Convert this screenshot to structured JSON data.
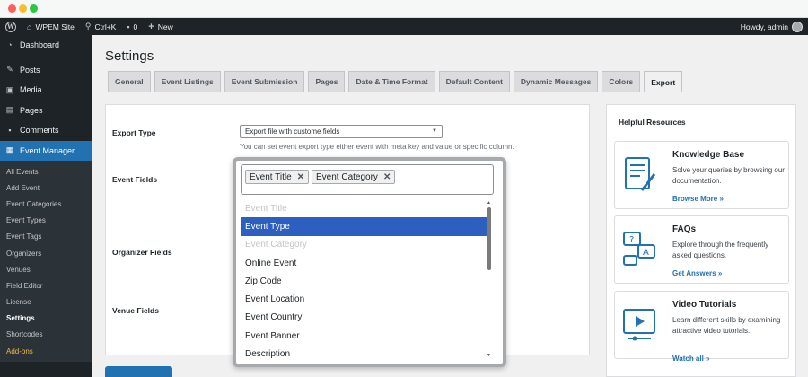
{
  "admin_bar": {
    "site_name": "WPEM Site",
    "shortcut": "Ctrl+K",
    "comments_count": "0",
    "new_label": "New",
    "greeting": "Howdy, admin"
  },
  "sidebar": {
    "top_items": [
      {
        "label": "Dashboard",
        "icon": "dashboard-icon"
      },
      {
        "label": "Posts",
        "icon": "pin-icon"
      },
      {
        "label": "Media",
        "icon": "media-icon"
      },
      {
        "label": "Pages",
        "icon": "pages-icon"
      },
      {
        "label": "Comments",
        "icon": "comment-icon"
      },
      {
        "label": "Event Manager",
        "icon": "calendar-icon"
      }
    ],
    "sub_items": [
      "All Events",
      "Add Event",
      "Event Categories",
      "Event Types",
      "Event Tags",
      "Organizers",
      "Venues",
      "Field Editor",
      "License",
      "Settings",
      "Shortcodes",
      "Add-ons"
    ]
  },
  "page": {
    "title": "Settings",
    "tabs": [
      "General",
      "Event Listings",
      "Event Submission",
      "Pages",
      "Date & Time Format",
      "Default Content",
      "Dynamic Messages",
      "Colors",
      "Export"
    ],
    "active_tab": "Export"
  },
  "form": {
    "export_type_label": "Export Type",
    "export_type_value": "Export file with custome fields",
    "export_type_desc": "You can set event export type either event with meta key and value or specific column.",
    "event_fields_label": "Event Fields",
    "organizer_fields_label": "Organizer Fields",
    "venue_fields_label": "Venue Fields",
    "selected_chips": [
      "Event Title",
      "Event Category"
    ],
    "dropdown_options": [
      {
        "label": "Event Title",
        "state": "disabled"
      },
      {
        "label": "Event Type",
        "state": "highlight"
      },
      {
        "label": "Event Category",
        "state": "disabled"
      },
      {
        "label": "Online Event",
        "state": "normal"
      },
      {
        "label": "Zip Code",
        "state": "normal"
      },
      {
        "label": "Event Location",
        "state": "normal"
      },
      {
        "label": "Event Country",
        "state": "normal"
      },
      {
        "label": "Event Banner",
        "state": "normal"
      },
      {
        "label": "Description",
        "state": "normal"
      }
    ]
  },
  "resources": {
    "title": "Helpful Resources",
    "cards": [
      {
        "heading": "Knowledge Base",
        "text": "Solve your queries by browsing our documentation.",
        "link": "Browse More »",
        "icon": "document-icon"
      },
      {
        "heading": "FAQs",
        "text": "Explore through the frequently asked questions.",
        "link": "Get Answers »",
        "icon": "faq-icon"
      },
      {
        "heading": "Video Tutorials",
        "text": "Learn different skills by examining attractive video tutorials.",
        "link": "Watch all »",
        "icon": "video-icon"
      }
    ]
  },
  "colors": {
    "accent": "#2271b1",
    "sidebar_bg": "#1d2327",
    "highlight": "#2c5fbf"
  }
}
